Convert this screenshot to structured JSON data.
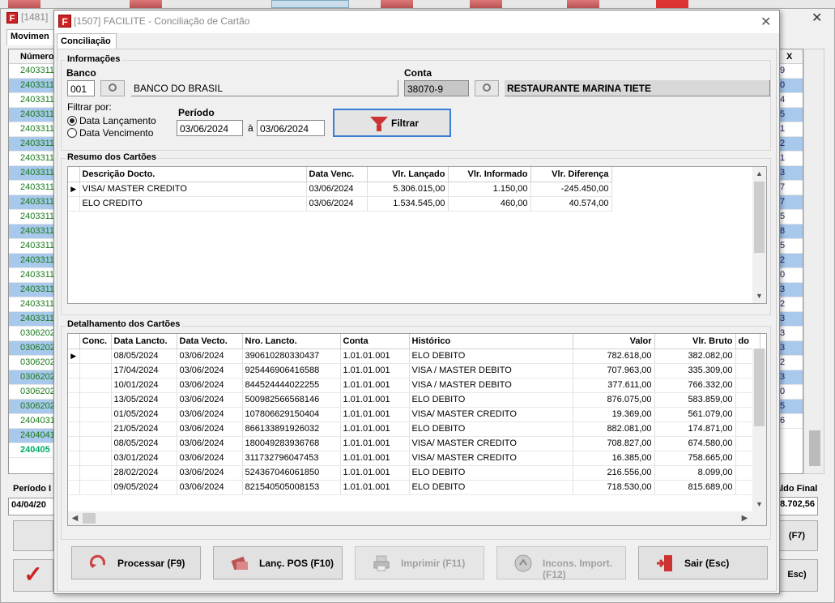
{
  "background": {
    "window_title": "[1481]",
    "tab_label": "Movimen",
    "grid_header": "Número",
    "grid_rows": [
      "2403311",
      "2403311",
      "2403311",
      "2403311",
      "2403311",
      "2403311",
      "2403311",
      "2403311",
      "2403311",
      "2403311",
      "2403311",
      "2403311",
      "2403311",
      "2403311",
      "2403311",
      "2403311",
      "2403311",
      "2403311",
      "0306202",
      "0306202",
      "0306202",
      "0306202",
      "0306202",
      "0306202",
      "2404031",
      "2404041",
      "240405"
    ],
    "right_header": "X",
    "right_cells": [
      "9",
      "0",
      "4",
      "5",
      "1",
      "2",
      "1",
      "3",
      "7",
      "7",
      "5",
      "8",
      "5",
      "2",
      "0",
      "3",
      "2",
      "3",
      "3",
      "3",
      "2",
      "3",
      "0",
      "5",
      "6"
    ],
    "periodo_label": "Período I",
    "periodo_value": "04/04/20",
    "saldo_label": "aldo Final",
    "saldo_value": "8.702,56",
    "btn_f7": "(F7)",
    "btn_esc": "Esc)"
  },
  "dialog": {
    "title": "[1507] FACILITE - Conciliação de Cartão",
    "tab": "Conciliação",
    "info_title": "Informações",
    "banco_label": "Banco",
    "banco_code": "001",
    "banco_name": "BANCO DO BRASIL",
    "conta_label": "Conta",
    "conta_value": "38070-9",
    "conta_name": "RESTAURANTE MARINA TIETE",
    "filtrar_label": "Filtrar por:",
    "radio1": "Data Lançamento",
    "radio2": "Data Vencimento",
    "periodo_label": "Período",
    "date_from": "03/06/2024",
    "date_sep": "à",
    "date_to": "03/06/2024",
    "filtrar_btn": "Filtrar",
    "resumo_title": "Resumo dos Cartões",
    "resumo_headers": [
      "Descrição Docto.",
      "Data Venc.",
      "Vlr. Lançado",
      "Vlr. Informado",
      "Vlr. Diferença"
    ],
    "resumo_rows": [
      [
        "VISA/ MASTER CREDITO",
        "03/06/2024",
        "5.306.015,00",
        "1.150,00",
        "-245.450,00"
      ],
      [
        "ELO CREDITO",
        "03/06/2024",
        "1.534.545,00",
        "460,00",
        "40.574,00"
      ]
    ],
    "detalhe_title": "Detalhamento dos Cartões",
    "detalhe_headers": [
      "Conc.",
      "Data Lancto.",
      "Data Vecto.",
      "Nro. Lancto.",
      "Conta",
      "Histórico",
      "Valor",
      "Vlr. Bruto",
      "do"
    ],
    "detalhe_rows": [
      [
        "",
        "08/05/2024",
        "03/06/2024",
        "390610280330437",
        "1.01.01.001",
        "ELO DEBITO",
        "782.618,00",
        "382.082,00"
      ],
      [
        "",
        "17/04/2024",
        "03/06/2024",
        "925446906416588",
        "1.01.01.001",
        "VISA /  MASTER DEBITO",
        "707.963,00",
        "335.309,00"
      ],
      [
        "",
        "10/01/2024",
        "03/06/2024",
        "844524444022255",
        "1.01.01.001",
        "VISA /  MASTER DEBITO",
        "377.611,00",
        "766.332,00"
      ],
      [
        "",
        "13/05/2024",
        "03/06/2024",
        "500982566568146",
        "1.01.01.001",
        "ELO DEBITO",
        "876.075,00",
        "583.859,00"
      ],
      [
        "",
        "01/05/2024",
        "03/06/2024",
        "107806629150404",
        "1.01.01.001",
        "VISA/ MASTER CREDITO",
        "19.369,00",
        "561.079,00"
      ],
      [
        "",
        "21/05/2024",
        "03/06/2024",
        "866133891926032",
        "1.01.01.001",
        "ELO DEBITO",
        "882.081,00",
        "174.871,00"
      ],
      [
        "",
        "08/05/2024",
        "03/06/2024",
        "180049283936768",
        "1.01.01.001",
        "VISA/ MASTER CREDITO",
        "708.827,00",
        "674.580,00"
      ],
      [
        "",
        "03/01/2024",
        "03/06/2024",
        "311732796047453",
        "1.01.01.001",
        "VISA/ MASTER CREDITO",
        "16.385,00",
        "758.665,00"
      ],
      [
        "",
        "28/02/2024",
        "03/06/2024",
        "524367046061850",
        "1.01.01.001",
        "ELO DEBITO",
        "216.556,00",
        "8.099,00"
      ],
      [
        "",
        "09/05/2024",
        "03/06/2024",
        "821540505008153",
        "1.01.01.001",
        "ELO DEBITO",
        "718.530,00",
        "815.689,00"
      ]
    ],
    "buttons": {
      "processar": "Processar (F9)",
      "lanc_pos": "Lanç. POS (F10)",
      "imprimir": "Imprimir (F11)",
      "incons": "Incons. Import. (F12)",
      "sair": "Sair (Esc)"
    }
  }
}
